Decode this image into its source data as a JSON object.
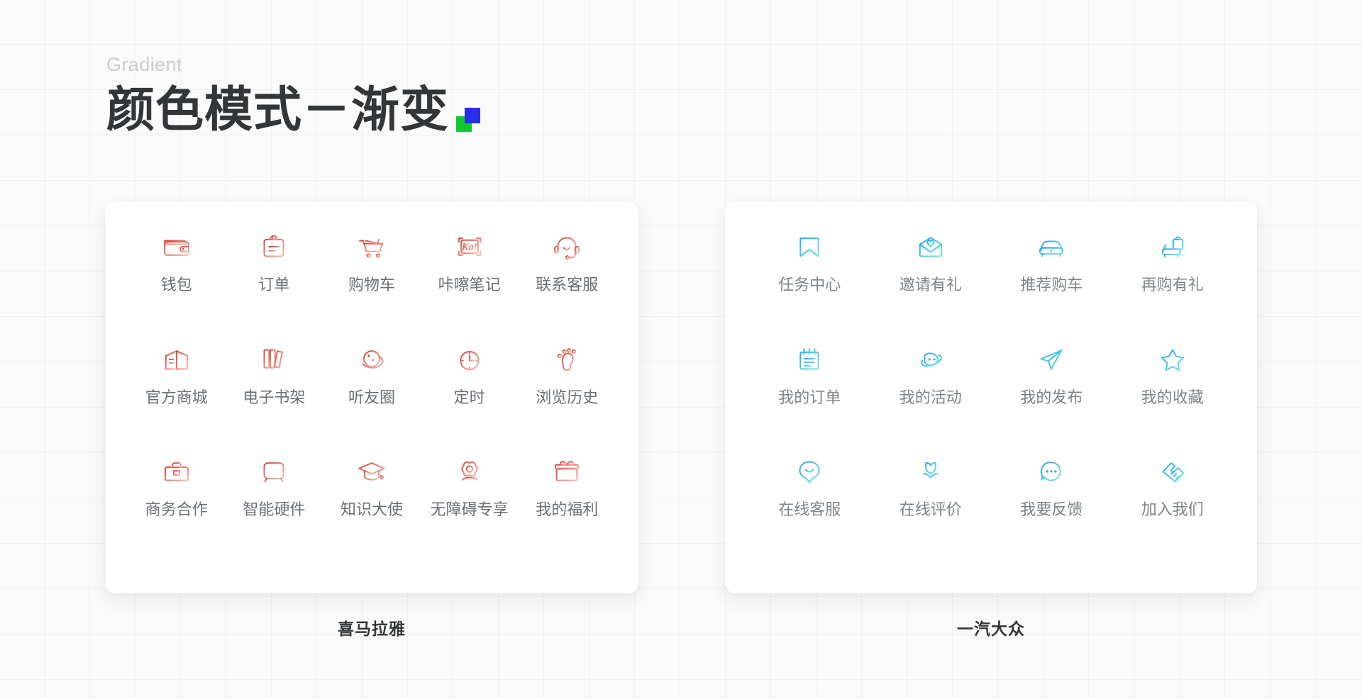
{
  "header": {
    "eyebrow": "Gradient",
    "title": "颜色模式－渐变",
    "mark": {
      "green": "#12c832",
      "blue": "#2b2ee8"
    }
  },
  "theme": {
    "background": "#fafafa",
    "card_background": "#ffffff",
    "title_color": "#333638",
    "eyebrow_color": "#c9cbcd",
    "label_color": "#6b7074",
    "warm_gradient_from": "#d94a3f",
    "warm_gradient_to": "#f2b0a3",
    "cool_gradient_from": "#2ea7ef",
    "cool_gradient_to": "#6fe3e1"
  },
  "cards": [
    {
      "id": "ximalaya",
      "caption": "喜马拉雅",
      "palette": "warm",
      "columns": 5,
      "items": [
        {
          "label": "钱包",
          "icon": "wallet-icon"
        },
        {
          "label": "订单",
          "icon": "clipboard-order-icon"
        },
        {
          "label": "购物车",
          "icon": "shopping-cart-icon"
        },
        {
          "label": "咔嚓笔记",
          "icon": "ka-note-icon",
          "icon_text": "Ka!"
        },
        {
          "label": "联系客服",
          "icon": "headset-support-icon"
        },
        {
          "label": "官方商城",
          "icon": "store-building-icon"
        },
        {
          "label": "电子书架",
          "icon": "bookshelf-icon"
        },
        {
          "label": "听友圈",
          "icon": "planet-circle-icon"
        },
        {
          "label": "定时",
          "icon": "stopwatch-timer-icon"
        },
        {
          "label": "浏览历史",
          "icon": "footprint-history-icon"
        },
        {
          "label": "商务合作",
          "icon": "briefcase-icon"
        },
        {
          "label": "智能硬件",
          "icon": "smart-speaker-icon"
        },
        {
          "label": "知识大使",
          "icon": "graduation-cap-icon"
        },
        {
          "label": "无障碍专享",
          "icon": "flower-accessibility-icon"
        },
        {
          "label": "我的福利",
          "icon": "gift-box-icon"
        }
      ]
    },
    {
      "id": "faw",
      "caption": "一汽大众",
      "palette": "cool",
      "columns": 4,
      "items": [
        {
          "label": "任务中心",
          "icon": "bookmark-task-icon"
        },
        {
          "label": "邀请有礼",
          "icon": "envelope-heart-icon"
        },
        {
          "label": "推荐购车",
          "icon": "car-front-icon"
        },
        {
          "label": "再购有礼",
          "icon": "car-giftbag-icon"
        },
        {
          "label": "我的订单",
          "icon": "notepad-order-icon"
        },
        {
          "label": "我的活动",
          "icon": "planet-face-icon"
        },
        {
          "label": "我的发布",
          "icon": "paper-plane-icon"
        },
        {
          "label": "我的收藏",
          "icon": "star-favorite-icon"
        },
        {
          "label": "在线客服",
          "icon": "smile-chat-bubble-icon"
        },
        {
          "label": "在线评价",
          "icon": "tulip-review-icon"
        },
        {
          "label": "我要反馈",
          "icon": "feedback-dots-icon"
        },
        {
          "label": "加入我们",
          "icon": "handshake-icon"
        }
      ]
    }
  ]
}
